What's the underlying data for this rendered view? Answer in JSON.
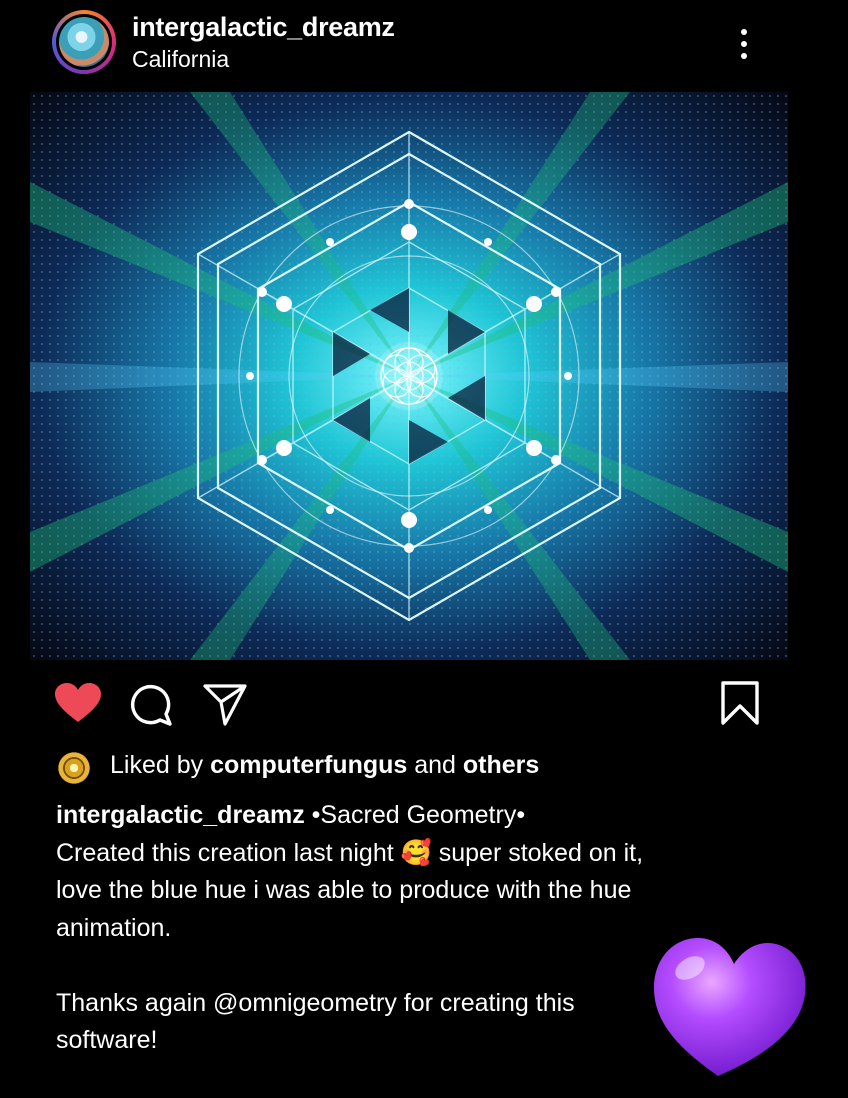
{
  "post": {
    "username": "intergalactic_dreamz",
    "location": "California"
  },
  "icons": {
    "more": "more-options-icon",
    "like": "heart-filled-icon",
    "comment": "comment-icon",
    "share": "share-icon",
    "save": "bookmark-icon",
    "sticker": "purple-heart-emoji",
    "caption_emoji": "smiling-face-with-hearts-emoji"
  },
  "colors": {
    "like": "#ed4956",
    "background": "#000000",
    "sticker": "#b44dff"
  },
  "likes": {
    "prefix": "Liked by ",
    "user": "computerfungus",
    "middle": " and ",
    "others": "others"
  },
  "caption": {
    "username": "intergalactic_dreamz",
    "title": " •Sacred Geometry•",
    "line1_a": "Created this creation last night ",
    "line1_emoji": "🥰",
    "line1_b": " super stoked on it,",
    "line2": "love the blue hue i was able to produce with the hue",
    "line3": "animation.",
    "line4": "Thanks again @omnigeometry for creating this",
    "line5": "software!"
  }
}
